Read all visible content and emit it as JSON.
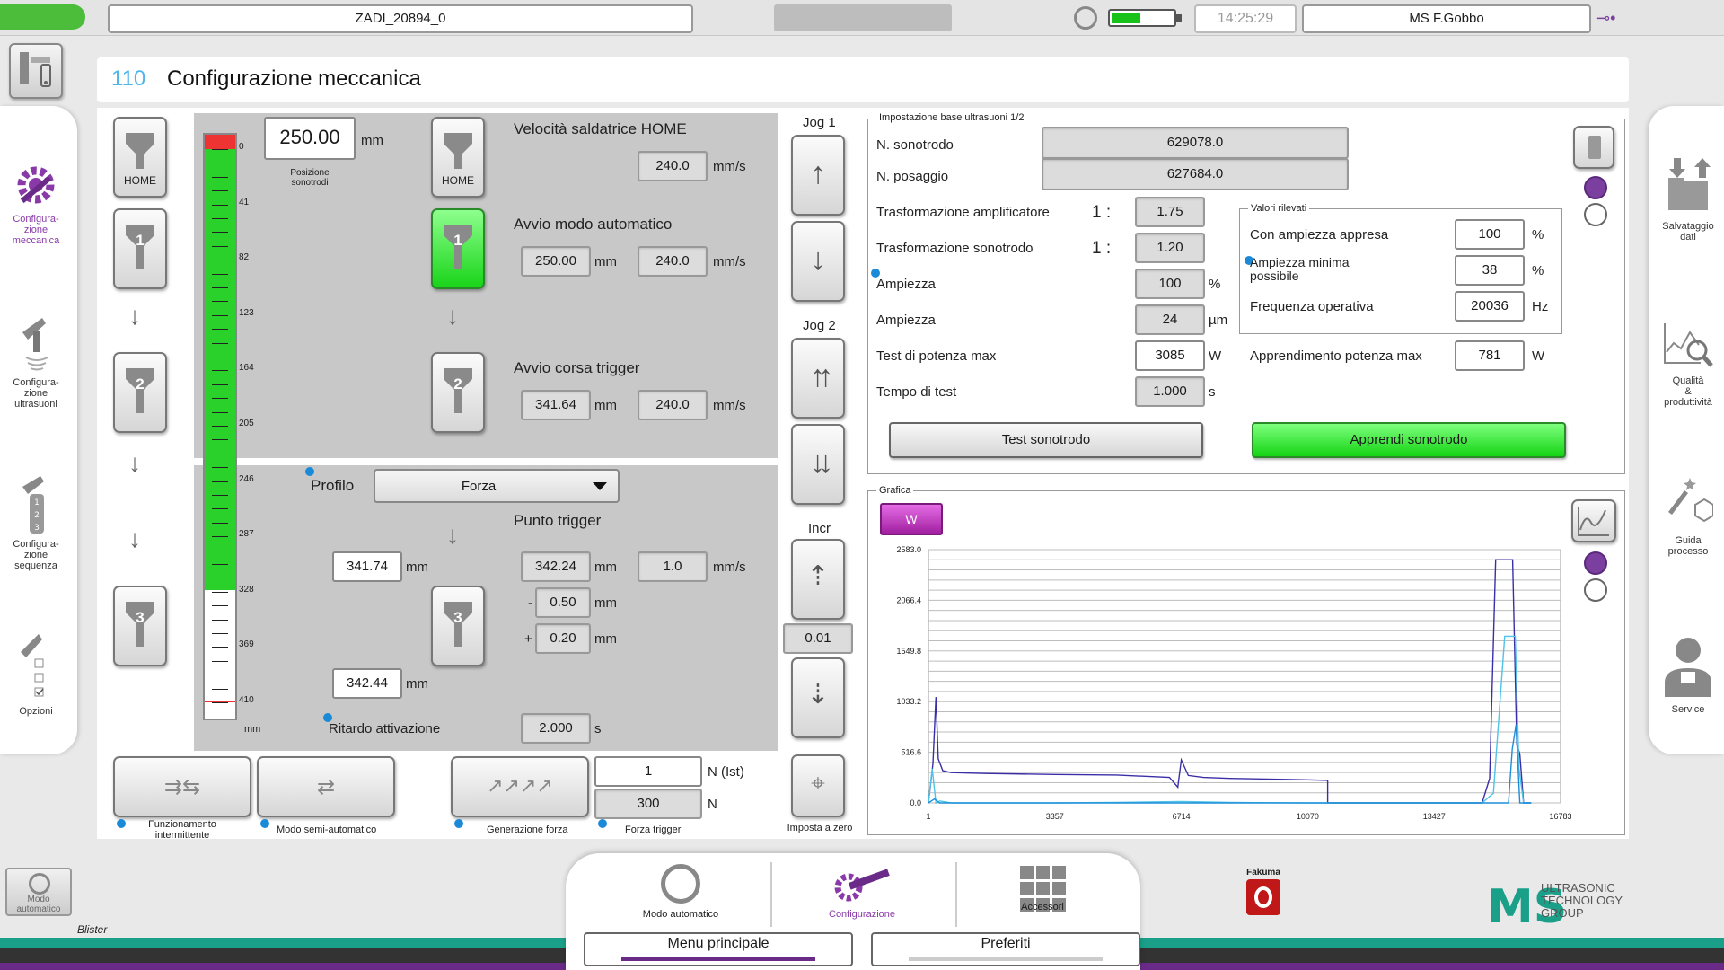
{
  "topbar": {
    "status_color": "#4bbd3a",
    "program_name": "ZADI_20894_0",
    "time": "14:25:29",
    "user": "MS F.Gobbo"
  },
  "page": {
    "number": "110",
    "title": "Configurazione meccanica"
  },
  "left_nav": [
    {
      "label_1": "Configura-",
      "label_2": "zione",
      "label_3": "meccanica",
      "icon": "gear-wrench-icon",
      "active": true
    },
    {
      "label_1": "Configura-",
      "label_2": "zione",
      "label_3": "ultrasuoni",
      "icon": "ultrasonic-tool-icon"
    },
    {
      "label_1": "Configura-",
      "label_2": "zione",
      "label_3": "sequenza",
      "icon": "sequence-icon"
    },
    {
      "label_1": "Opzioni",
      "label_2": "",
      "label_3": "",
      "icon": "options-icon"
    }
  ],
  "right_nav": [
    {
      "label_1": "Salvataggio",
      "label_2": "dati",
      "label_3": ""
    },
    {
      "label_1": "Qualità",
      "label_2": "&",
      "label_3": "produttività"
    },
    {
      "label_1": "Guida",
      "label_2": "processo",
      "label_3": ""
    },
    {
      "label_1": "Service",
      "label_2": "",
      "label_3": ""
    }
  ],
  "ruler": {
    "ticks": [
      "0",
      "41",
      "82",
      "123",
      "164",
      "205",
      "246",
      "287",
      "328",
      "369",
      "410"
    ],
    "unit": "mm",
    "fill_fraction": 0.78
  },
  "position": {
    "value": "250.00",
    "unit": "mm",
    "label_1": "Posizione",
    "label_2": "sonotrodi"
  },
  "tools": {
    "home": "HOME",
    "n1": "1",
    "n2": "2",
    "n3": "3"
  },
  "home_section": {
    "title": "Velocità saldatrice HOME",
    "speed": "240.0",
    "speed_unit": "mm/s"
  },
  "auto_section": {
    "title": "Avvio modo automatico",
    "pos": "250.00",
    "pos_unit": "mm",
    "speed": "240.0",
    "speed_unit": "mm/s"
  },
  "trigger_run": {
    "title": "Avvio corsa trigger",
    "pos": "341.64",
    "pos_unit": "mm",
    "speed": "240.0",
    "speed_unit": "mm/s"
  },
  "profile": {
    "label": "Profilo",
    "value": "Forza"
  },
  "trigger_point": {
    "title": "Punto trigger",
    "left_pos": "341.74",
    "left_unit": "mm",
    "pos": "342.24",
    "pos_unit": "mm",
    "speed": "1.0",
    "speed_unit": "mm/s",
    "minus_sign": "-",
    "minus_val": "0.50",
    "minus_unit": "mm",
    "plus_sign": "+",
    "plus_val": "0.20",
    "plus_unit": "mm",
    "bottom_pos": "342.44",
    "bottom_unit": "mm"
  },
  "delay": {
    "label": "Ritardo attivazione",
    "value": "2.000",
    "unit": "s"
  },
  "jog": {
    "jog1": "Jog 1",
    "jog2": "Jog 2",
    "incr": "Incr",
    "incr_value": "0.01",
    "zero_label": "Imposta a zero"
  },
  "bottom_buttons": {
    "intermittent_1": "Funzionamento",
    "intermittent_2": "intermittente",
    "semi_auto": "Modo semi-automatico",
    "force_gen": "Generazione forza",
    "force_trigger": "Forza trigger",
    "force_ist": "1",
    "force_ist_unit": "N (Ist)",
    "force_set": "300",
    "force_set_unit": "N"
  },
  "ultrasound": {
    "legend": "Impostazione base ultrasuoni 1/2",
    "sonotrode_label": "N. sonotrodo",
    "sonotrode_value": "629078.0",
    "fixture_label": "N. posaggio",
    "fixture_value": "627684.0",
    "amp_trans_label": "Trasformazione amplificatore",
    "amp_trans_ratio": "1 :",
    "amp_trans_value": "1.75",
    "son_trans_label": "Trasformazione sonotrodo",
    "son_trans_ratio": "1 :",
    "son_trans_value": "1.20",
    "amp_pct_label": "Ampiezza",
    "amp_pct_value": "100",
    "amp_pct_unit": "%",
    "amp_um_label": "Ampiezza",
    "amp_um_value": "24",
    "amp_um_unit": "µm",
    "power_test_label": "Test di potenza max",
    "power_test_value": "3085",
    "power_test_unit": "W",
    "test_time_label": "Tempo di test",
    "test_time_value": "1.000",
    "test_time_unit": "s",
    "measured_legend": "Valori rilevati",
    "learned_amp_label": "Con ampiezza appresa",
    "learned_amp_value": "100",
    "learned_amp_unit": "%",
    "min_amp_label_1": "Ampiezza minima",
    "min_amp_label_2": "possibile",
    "min_amp_value": "38",
    "min_amp_unit": "%",
    "freq_label": "Frequenza operativa",
    "freq_value": "20036",
    "freq_unit": "Hz",
    "learn_power_label": "Apprendimento potenza max",
    "learn_power_value": "781",
    "learn_power_unit": "W",
    "test_button": "Test sonotrodo",
    "learn_button": "Apprendi sonotrodo"
  },
  "chart_data": {
    "type": "line",
    "legend_title": "Grafica",
    "series_button": "W",
    "x_ticks": [
      "1",
      "3357",
      "6714",
      "10070",
      "13427",
      "16783"
    ],
    "y_ticks": [
      "0.0",
      "516.6",
      "1033.2",
      "1549.8",
      "2066.4",
      "2583.0"
    ],
    "xlim": [
      1,
      16783
    ],
    "ylim": [
      0,
      2583
    ],
    "series": [
      {
        "color": "#3a2fa8",
        "x": [
          1,
          120,
          200,
          260,
          380,
          600,
          1500,
          3357,
          5000,
          6400,
          6620,
          6714,
          6900,
          7300,
          8000,
          9500,
          10070,
          10600,
          10600,
          11500,
          13427,
          14700,
          14900,
          15060,
          15150,
          15420,
          15510,
          15620,
          15700,
          15800,
          16000
        ],
        "y": [
          0,
          400,
          1080,
          450,
          330,
          310,
          300,
          290,
          285,
          260,
          160,
          440,
          280,
          260,
          250,
          240,
          235,
          230,
          0,
          0,
          0,
          0,
          250,
          2480,
          2480,
          2480,
          2480,
          600,
          500,
          0,
          0
        ]
      },
      {
        "color": "#4fc3e8",
        "x": [
          1,
          100,
          200,
          300,
          600,
          3357,
          5000,
          6714,
          8000,
          10070,
          10600,
          11500,
          13427,
          14700,
          15000,
          15300,
          15580,
          15680,
          15800,
          16000
        ],
        "y": [
          0,
          350,
          0,
          20,
          0,
          0,
          5,
          15,
          5,
          0,
          0,
          0,
          0,
          0,
          100,
          1700,
          1700,
          350,
          0,
          0
        ]
      },
      {
        "color": "#1d8fd9",
        "x": [
          1,
          160,
          300,
          3357,
          6714,
          10070,
          13427,
          15400,
          15500,
          15600,
          15700,
          16000
        ],
        "y": [
          0,
          40,
          0,
          0,
          0,
          0,
          0,
          0,
          550,
          800,
          0,
          0
        ]
      }
    ]
  },
  "bottom_nav": {
    "auto_mode": "Modo automatico",
    "config": "Configurazione",
    "accessories": "Accessori",
    "menu": "Menu principale",
    "favorites": "Preferiti",
    "corner_label_1": "Modo",
    "corner_label_2": "automatico",
    "machine": "Blister",
    "brand_1": "ULTRASONIC",
    "brand_2": "TECHNOLOGY",
    "brand_3": "GROUP",
    "fakuma": "Fakuma"
  }
}
